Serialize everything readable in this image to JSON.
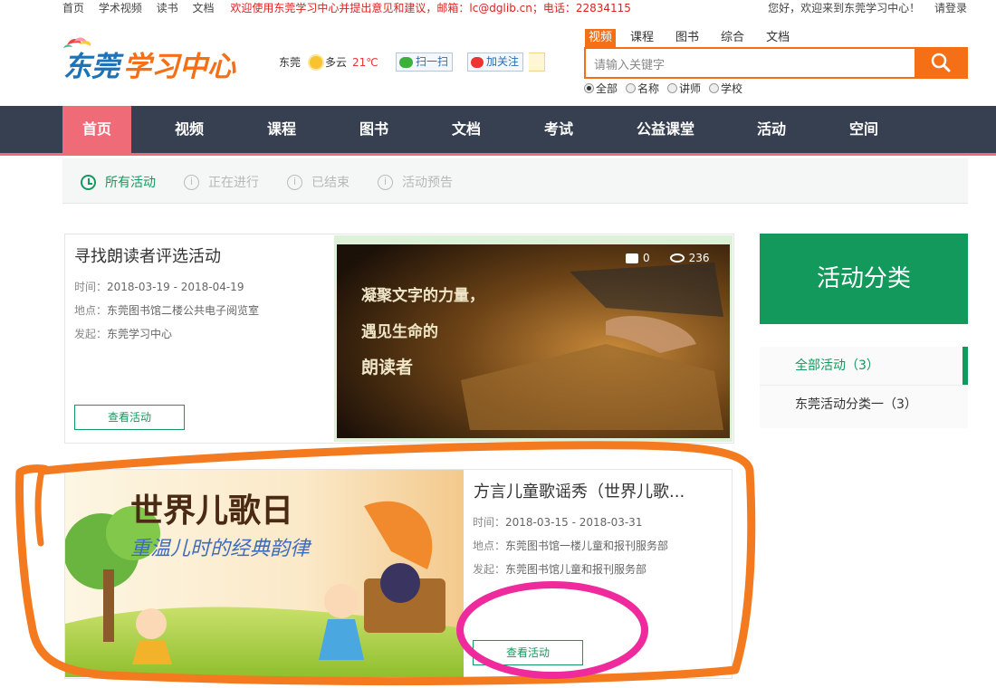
{
  "topbar": {
    "links": [
      "首页",
      "学术视频",
      "读书",
      "文档"
    ],
    "notice": "欢迎使用东莞学习中心并提出意见和建议，邮箱：lc@dglib.cn；电话：22834115",
    "welcome": "您好，欢迎来到东莞学习中心！",
    "login": "请登录"
  },
  "header": {
    "logo_text": "东莞学习中心",
    "weather": {
      "city": "东莞",
      "condition": "多云",
      "temp": "21℃"
    },
    "scan_label": "扫一扫",
    "follow_label": "加关注",
    "search": {
      "tabs": [
        "视频",
        "课程",
        "图书",
        "综合",
        "文档"
      ],
      "active_tab": 0,
      "placeholder": "请输入关键字",
      "filters": [
        "全部",
        "名称",
        "讲师",
        "学校"
      ],
      "selected_filter": 0
    }
  },
  "nav": {
    "items": [
      "首页",
      "视频",
      "课程",
      "图书",
      "文档",
      "考试",
      "公益课堂",
      "活动",
      "空间"
    ],
    "active": 0
  },
  "subtabs": {
    "items": [
      "所有活动",
      "正在进行",
      "已结束",
      "活动预告"
    ],
    "active": 0
  },
  "activities": [
    {
      "title": "寻找朗读者评选活动",
      "time_label": "时间：",
      "time": "2018-03-19 - 2018-04-19",
      "place_label": "地点：",
      "place": "东莞图书馆二楼公共电子阅览室",
      "org_label": "发起：",
      "org": "东莞学习中心",
      "view_label": "查看活动",
      "comments": "0",
      "views": "236",
      "image_text": [
        "凝聚文字的力量，",
        "遇见生命的",
        "朗读者"
      ]
    },
    {
      "title": "方言儿童歌谣秀（世界儿歌...",
      "time_label": "时间：",
      "time": "2018-03-15 - 2018-03-31",
      "place_label": "地点：",
      "place": "东莞图书馆一楼儿童和报刊服务部",
      "org_label": "发起：",
      "org": "东莞图书馆儿童和报刊服务部",
      "view_label": "查看活动",
      "image_text": [
        "世界儿歌日",
        "重温儿时的经典韵律"
      ]
    }
  ],
  "sidebar": {
    "title": "活动分类",
    "items": [
      "全部活动（3）",
      "东莞活动分类一（3）"
    ],
    "active": 0
  },
  "colors": {
    "brand_orange": "#f56f17",
    "nav_bg": "#374050",
    "nav_active": "#ef6b78",
    "green": "#14995d",
    "annotation_orange": "#f47a20",
    "annotation_pink": "#ee2a9c"
  },
  "icons": [
    "sun-icon",
    "wechat-icon",
    "weibo-icon",
    "search-icon",
    "clock-icon",
    "info-icon",
    "comment-icon",
    "eye-icon"
  ]
}
